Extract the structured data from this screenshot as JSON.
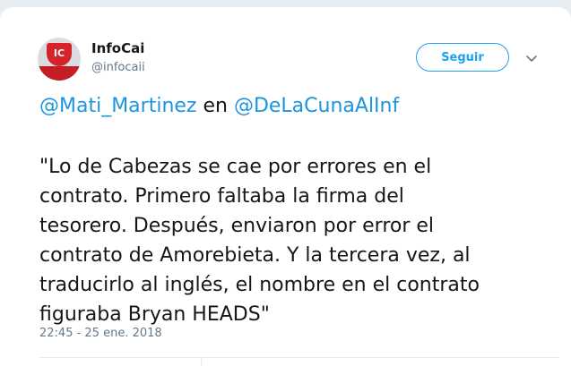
{
  "tweet": {
    "author": {
      "name": "InfoCai",
      "handle": "@infocaii",
      "avatar_initials": "IC",
      "avatar_color": "#d6222a"
    },
    "follow_label": "Seguir",
    "mention_line": {
      "mention_1": "@Mati_Martinez",
      "connector": " en ",
      "mention_2": "@DeLaCunaAlInf"
    },
    "text_lines": [
      "\"Lo de Cabezas se cae por errores en el",
      "contrato. Primero faltaba la firma del",
      "tesorero. Después, enviaron por error el",
      "contrato de Amorebieta. Y la tercera vez, al",
      "traducirlo al inglés, el nombre en el contrato",
      "figuraba Bryan HEADS\""
    ],
    "timestamp": "22:45 - 25 ene. 2018",
    "icons": {
      "caret": "chevron-down-icon"
    },
    "colors": {
      "link": "#1b95e0",
      "accent": "#1da1f2",
      "text": "#14171a",
      "muted": "#657786"
    }
  }
}
